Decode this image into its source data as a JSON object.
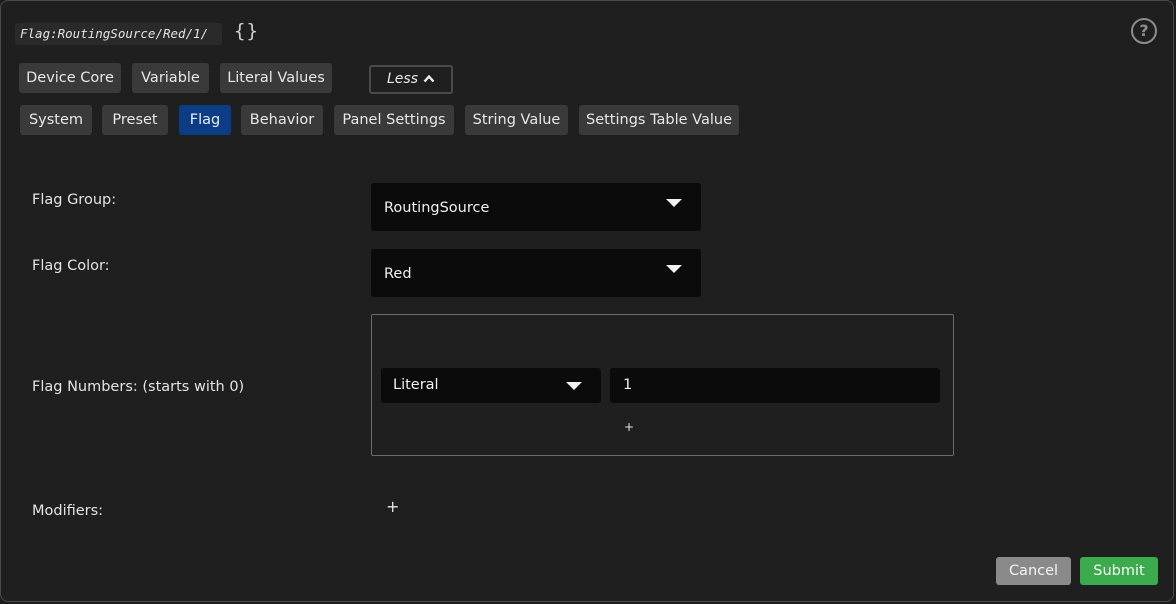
{
  "header": {
    "path": "Flag:RoutingSource/Red/1/",
    "braces": "{}",
    "help_glyph": "?"
  },
  "type_tabs_row1": [
    {
      "label": "Device Core"
    },
    {
      "label": "Variable"
    },
    {
      "label": "Literal Values"
    }
  ],
  "less_toggle": {
    "label": "Less",
    "chevron": "^"
  },
  "type_tabs_row2": [
    {
      "label": "System"
    },
    {
      "label": "Preset"
    },
    {
      "label": "Flag",
      "active": true
    },
    {
      "label": "Behavior"
    },
    {
      "label": "Panel Settings"
    },
    {
      "label": "String Value"
    },
    {
      "label": "Settings Table Value"
    }
  ],
  "form": {
    "flag_group": {
      "label": "Flag Group:",
      "value": "RoutingSource"
    },
    "flag_color": {
      "label": "Flag Color:",
      "value": "Red"
    },
    "flag_numbers": {
      "label": "Flag Numbers: (starts with 0)",
      "entry_type": "Literal",
      "entry_value": "1",
      "add_glyph": "+"
    },
    "modifiers": {
      "label": "Modifiers:",
      "add_glyph": "+"
    }
  },
  "footer": {
    "cancel_label": "Cancel",
    "submit_label": "Submit"
  },
  "colors": {
    "background": "#1f1f20",
    "tab": "#3a3a3b",
    "tab_active": "#0c3c86",
    "select_bg": "#0b0b0b",
    "cancel": "#8a8a8a",
    "submit": "#3cab4e"
  }
}
